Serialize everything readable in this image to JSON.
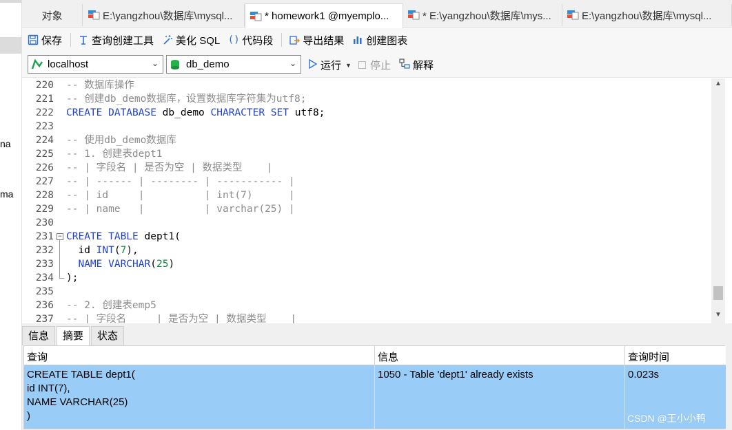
{
  "tabs": [
    {
      "label": "对象"
    },
    {
      "label": "E:\\yangzhou\\数据库\\mysql..."
    },
    {
      "label": "* homework1 @myemplo..."
    },
    {
      "label": "* E:\\yangzhou\\数据库\\mys..."
    },
    {
      "label": "E:\\yangzhou\\数据库\\mysql..."
    }
  ],
  "toolbar": {
    "save": "保存",
    "query_builder": "查询创建工具",
    "beautify": "美化 SQL",
    "snippet": "代码段",
    "export": "导出结果",
    "chart": "创建图表"
  },
  "connection": {
    "server": "localhost",
    "database": "db_demo",
    "run": "运行",
    "stop": "停止",
    "explain": "解释"
  },
  "left_fragments": [
    "na",
    "ma"
  ],
  "editor": {
    "lines": [
      {
        "n": "220",
        "parts": [
          {
            "t": "-- 数据库操作",
            "c": "cmt"
          }
        ]
      },
      {
        "n": "221",
        "parts": [
          {
            "t": "-- 创建db_demo数据库，设置数据库字符集为utf8;",
            "c": "cmt"
          }
        ]
      },
      {
        "n": "222",
        "parts": [
          {
            "t": "CREATE DATABASE",
            "c": "kw"
          },
          {
            "t": " db_demo ",
            "c": ""
          },
          {
            "t": "CHARACTER SET",
            "c": "kw"
          },
          {
            "t": " utf8;",
            "c": ""
          }
        ]
      },
      {
        "n": "223",
        "parts": []
      },
      {
        "n": "224",
        "parts": [
          {
            "t": "-- 使用db_demo数据库",
            "c": "cmt"
          }
        ]
      },
      {
        "n": "225",
        "parts": [
          {
            "t": "-- 1. 创建表dept1",
            "c": "cmt"
          }
        ]
      },
      {
        "n": "226",
        "parts": [
          {
            "t": "-- | 字段名 | 是否为空 | 数据类型    |",
            "c": "cmt"
          }
        ]
      },
      {
        "n": "227",
        "parts": [
          {
            "t": "-- | ------ | -------- | ----------- |",
            "c": "cmt"
          }
        ]
      },
      {
        "n": "228",
        "parts": [
          {
            "t": "-- | id     |          | int(7)      |",
            "c": "cmt"
          }
        ]
      },
      {
        "n": "229",
        "parts": [
          {
            "t": "-- | name   |          | varchar(25) |",
            "c": "cmt"
          }
        ]
      },
      {
        "n": "230",
        "parts": []
      },
      {
        "n": "231",
        "parts": [
          {
            "t": "CREATE TABLE",
            "c": "kw"
          },
          {
            "t": " dept1(",
            "c": ""
          }
        ]
      },
      {
        "n": "232",
        "parts": [
          {
            "t": "  id ",
            "c": ""
          },
          {
            "t": "INT",
            "c": "kw"
          },
          {
            "t": "(",
            "c": ""
          },
          {
            "t": "7",
            "c": "num"
          },
          {
            "t": "),",
            "c": ""
          }
        ]
      },
      {
        "n": "233",
        "parts": [
          {
            "t": "  ",
            "c": ""
          },
          {
            "t": "NAME VARCHAR",
            "c": "kw"
          },
          {
            "t": "(",
            "c": ""
          },
          {
            "t": "25",
            "c": "num"
          },
          {
            "t": ")",
            "c": ""
          }
        ]
      },
      {
        "n": "234",
        "parts": [
          {
            "t": ");",
            "c": ""
          }
        ]
      },
      {
        "n": "235",
        "parts": []
      },
      {
        "n": "236",
        "parts": [
          {
            "t": "-- 2. 创建表emp5",
            "c": "cmt"
          }
        ]
      },
      {
        "n": "237",
        "parts": [
          {
            "t": "-- | 字段名     | 是否为空 | 数据类型    |",
            "c": "cmt"
          }
        ]
      }
    ]
  },
  "result_tabs": [
    "信息",
    "摘要",
    "状态"
  ],
  "result_grid": {
    "headers": [
      "查询",
      "信息",
      "查询时间"
    ],
    "row": {
      "query": "CREATE TABLE dept1(\nid INT(7),\nNAME VARCHAR(25)\n)",
      "message": "1050 - Table 'dept1' already exists",
      "time": "0.023s"
    }
  },
  "watermark": "CSDN @王小小鸭",
  "colors": {
    "selection_row": "#99ccf7",
    "keyword": "#1f3fd0",
    "comment": "#8c8c8c",
    "number": "#0a8a3a"
  }
}
